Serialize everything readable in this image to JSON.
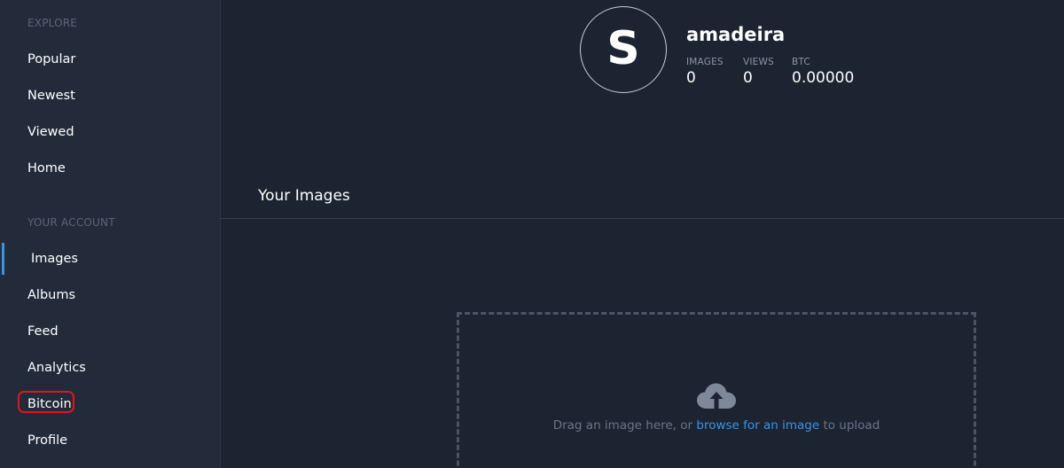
{
  "sidebar": {
    "explore_title": "EXPLORE",
    "explore_items": [
      {
        "label": "Popular"
      },
      {
        "label": "Newest"
      },
      {
        "label": "Viewed"
      },
      {
        "label": "Home"
      }
    ],
    "account_title": "YOUR ACCOUNT",
    "account_items": [
      {
        "label": "Images",
        "active": true
      },
      {
        "label": "Albums"
      },
      {
        "label": "Feed"
      },
      {
        "label": "Analytics"
      },
      {
        "label": "Bitcoin",
        "highlighted": true
      },
      {
        "label": "Profile"
      }
    ]
  },
  "profile": {
    "avatar_letter": "S",
    "username": "amadeira",
    "stats": [
      {
        "label": "IMAGES",
        "value": "0"
      },
      {
        "label": "VIEWS",
        "value": "0"
      },
      {
        "label": "BTC",
        "value": "0.00000"
      }
    ]
  },
  "images_section": {
    "title": "Your Images"
  },
  "upload": {
    "icon": "cloud-upload-icon",
    "text_before": "Drag an image here, or ",
    "link_text": "browse for an image",
    "text_after": " to upload"
  },
  "colors": {
    "background": "#1c2331",
    "sidebar": "#232b3b",
    "accent": "#3a94e6",
    "highlight_ring": "#e0141e"
  }
}
